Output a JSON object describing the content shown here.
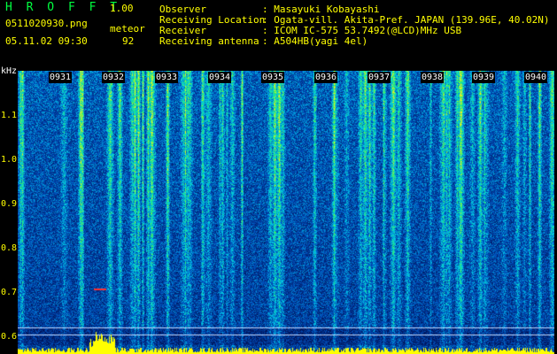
{
  "header": {
    "app_title": "H R O F F T",
    "version": "1.00",
    "filename": "0511020930.png",
    "detection_label": "meteor",
    "datetime": "05.11.02 09:30",
    "meteor_count": "92"
  },
  "info": {
    "observer_label": "Observer",
    "observer_value": ": Masayuki Kobayashi",
    "location_label": "Receiving Location",
    "location_value": ": Ogata-vill. Akita-Pref. JAPAN (139.96E, 40.02N)",
    "receiver_label": "Receiver",
    "receiver_value": ": ICOM IC-575 53.7492(@LCD)MHz USB",
    "antenna_label": "Receiving antenna",
    "antenna_value": ": A504HB(yagi 4el)"
  },
  "axis": {
    "unit": "kHz",
    "y_ticks": [
      "1.1",
      "1.0",
      "0.9",
      "0.8",
      "0.7",
      "0.6"
    ],
    "time_ticks": [
      "0931",
      "0932",
      "0933",
      "0934",
      "0935",
      "0936",
      "0937",
      "0938",
      "0939",
      "0940"
    ]
  },
  "colors": {
    "background": "#000000",
    "spectrogram_base": "#002a80",
    "title_green": "#00ff40",
    "label_yellow": "#ffff00",
    "text_white": "#ffffff"
  }
}
